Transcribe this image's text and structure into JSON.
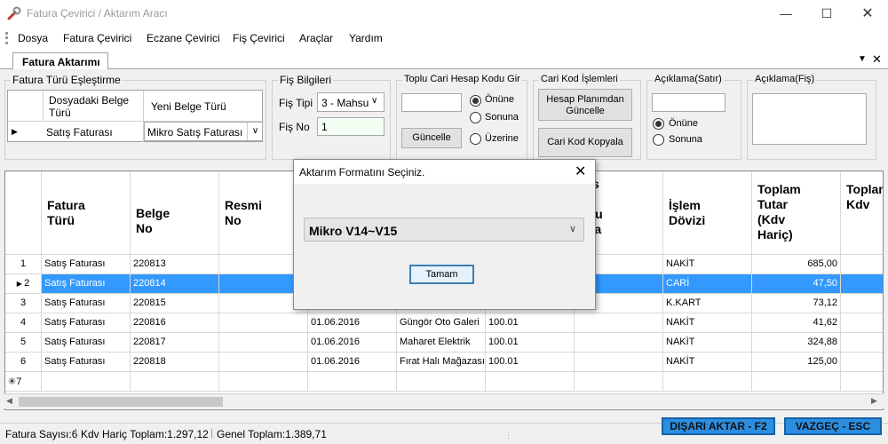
{
  "window": {
    "title": "Fatura Çevirici / Aktarım Aracı"
  },
  "menu": [
    "Dosya",
    "Fatura Çevirici",
    "Eczane Çevirici",
    "Fiş Çevirici",
    "Araçlar",
    "Yardım"
  ],
  "tab": {
    "label": "Fatura Aktarımı"
  },
  "invoice_type": {
    "group_label": "Fatura Türü Eşleştirme",
    "col1": "Dosyadaki Belge Türü",
    "col2": "Yeni Belge Türü",
    "row_source": "Satış Faturası",
    "row_target": "Mikro Satış Faturası"
  },
  "fis": {
    "group_label": "Fiş Bilgileri",
    "tipi_label": "Fiş Tipi",
    "tipi_value": "3 - Mahsu",
    "no_label": "Fiş No",
    "no_value": "1"
  },
  "bulk_account": {
    "group_label": "Toplu Cari Hesap Kodu Gir",
    "input_value": "",
    "update_button": "Güncelle",
    "options": [
      "Önüne",
      "Sonuna",
      "Üzerine"
    ],
    "selected": "Önüne"
  },
  "account_ops": {
    "group_label": "Cari Kod İşlemleri",
    "plan_button": "Hesap Planımdan Güncelle",
    "copy_button": "Cari Kod Kopyala"
  },
  "line_note": {
    "group_label": "Açıklama(Satır)",
    "input_value": "",
    "options": [
      "Önüne",
      "Sonuna"
    ],
    "selected": "Önüne"
  },
  "receipt_note": {
    "group_label": "Açıklama(Fiş)",
    "input_value": ""
  },
  "grid": {
    "columns": [
      "Fatura Türü",
      "Belge No",
      "Resmi No",
      "",
      "",
      "/Bs ri odu uca n)",
      "İşlem Dövizi",
      "Toplam Tutar (Kdv Hariç)",
      "Toplam Kdv"
    ],
    "rows": [
      {
        "n": "1",
        "type": "Satış Faturası",
        "doc": "220813",
        "date": "",
        "name": "",
        "code": "",
        "cur": "NAKİT",
        "total": "685,00"
      },
      {
        "n": "2",
        "type": "Satış Faturası",
        "doc": "220814",
        "date": "",
        "name": "",
        "code": "",
        "cur": "CARİ",
        "total": "47,50"
      },
      {
        "n": "3",
        "type": "Satış Faturası",
        "doc": "220815",
        "date": "",
        "name": "",
        "code": "",
        "cur": "K.KART",
        "total": "73,12"
      },
      {
        "n": "4",
        "type": "Satış Faturası",
        "doc": "220816",
        "date": "01.06.2016",
        "name": "Güngör Oto Galeri",
        "code": "100.01",
        "cur": "NAKİT",
        "total": "41,62"
      },
      {
        "n": "5",
        "type": "Satış Faturası",
        "doc": "220817",
        "date": "01.06.2016",
        "name": "Maharet Elektrik",
        "code": "100.01",
        "cur": "NAKİT",
        "total": "324,88"
      },
      {
        "n": "6",
        "type": "Satış Faturası",
        "doc": "220818",
        "date": "01.06.2016",
        "name": "Fırat Halı Mağazası",
        "code": "100.01",
        "cur": "NAKİT",
        "total": "125,00"
      }
    ],
    "new_row": "7",
    "selected_row": "2"
  },
  "dialog": {
    "title": "Aktarım Formatını Seçiniz.",
    "format_value": "Mikro V14~V15",
    "ok_button": "Tamam"
  },
  "status": {
    "count": "Fatura Sayısı:6",
    "net_total": "Kdv Hariç Toplam:1.297,12",
    "grand_total": "Genel Toplam:1.389,71"
  },
  "actions": {
    "export": "DIŞARI AKTAR - F2",
    "cancel": "VAZGEÇ - ESC"
  },
  "colors": {
    "selection": "#3399ff",
    "action_button": "#2c8ee0"
  }
}
